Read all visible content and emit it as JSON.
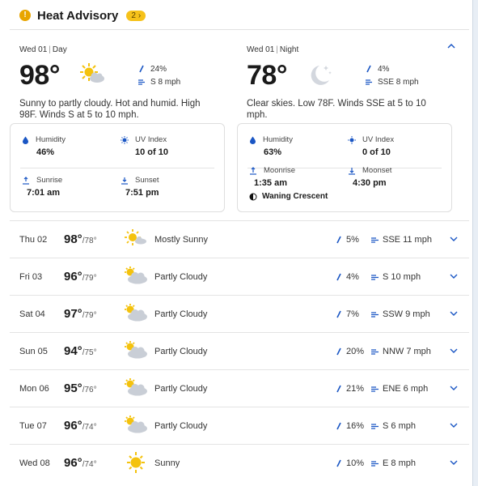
{
  "advisory": {
    "title": "Heat Advisory",
    "count": "2",
    "count_arrow": "›"
  },
  "day_panel": {
    "date": "Wed 01",
    "period": "Day",
    "temp": "98°",
    "precip": "24%",
    "wind": "S 8 mph",
    "description": "Sunny to partly cloudy. Hot and humid. High 98F. Winds S at 5 to 10 mph.",
    "humidity_label": "Humidity",
    "humidity": "46%",
    "uv_label": "UV Index",
    "uv": "10 of 10",
    "sunrise_label": "Sunrise",
    "sunrise": "7:01 am",
    "sunset_label": "Sunset",
    "sunset": "7:51 pm",
    "icon": "partly-sunny-icon"
  },
  "night_panel": {
    "date": "Wed 01",
    "period": "Night",
    "temp": "78°",
    "precip": "4%",
    "wind": "SSE 8 mph",
    "description": "Clear skies. Low 78F. Winds SSE at 5 to 10 mph.",
    "humidity_label": "Humidity",
    "humidity": "63%",
    "uv_label": "UV Index",
    "uv": "0 of 10",
    "moonrise_label": "Moonrise",
    "moonrise": "1:35 am",
    "moonset_label": "Moonset",
    "moonset": "4:30 pm",
    "moon_phase": "Waning Crescent",
    "icon": "clear-night-moon-icon"
  },
  "forecast": [
    {
      "day": "Thu 02",
      "hi": "98°",
      "lo": "/78°",
      "cond": "Mostly Sunny",
      "precip": "5%",
      "wind": "SSE 11 mph",
      "icon": "mostly-sunny"
    },
    {
      "day": "Fri 03",
      "hi": "96°",
      "lo": "/79°",
      "cond": "Partly Cloudy",
      "precip": "4%",
      "wind": "S 10 mph",
      "icon": "partly-cloudy"
    },
    {
      "day": "Sat 04",
      "hi": "97°",
      "lo": "/79°",
      "cond": "Partly Cloudy",
      "precip": "7%",
      "wind": "SSW 9 mph",
      "icon": "partly-cloudy"
    },
    {
      "day": "Sun 05",
      "hi": "94°",
      "lo": "/75°",
      "cond": "Partly Cloudy",
      "precip": "20%",
      "wind": "NNW 7 mph",
      "icon": "partly-cloudy"
    },
    {
      "day": "Mon 06",
      "hi": "95°",
      "lo": "/76°",
      "cond": "Partly Cloudy",
      "precip": "21%",
      "wind": "ENE 6 mph",
      "icon": "partly-cloudy"
    },
    {
      "day": "Tue 07",
      "hi": "96°",
      "lo": "/74°",
      "cond": "Partly Cloudy",
      "precip": "16%",
      "wind": "S 6 mph",
      "icon": "partly-cloudy"
    },
    {
      "day": "Wed 08",
      "hi": "96°",
      "lo": "/74°",
      "cond": "Sunny",
      "precip": "10%",
      "wind": "E 8 mph",
      "icon": "sunny"
    }
  ],
  "colors": {
    "accent": "#1a56c4",
    "sun": "#f4c20d",
    "cloud": "#c9ced6",
    "advisory": "#f6c21a"
  }
}
